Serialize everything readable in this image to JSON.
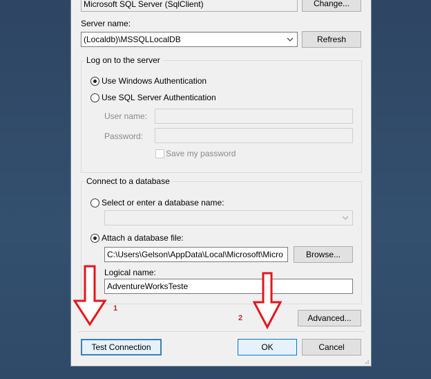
{
  "data_source": {
    "value": "Microsoft SQL Server (SqlClient)",
    "change_label": "Change..."
  },
  "server": {
    "label": "Server name:",
    "value": "(Localdb)\\MSSQLLocalDB",
    "refresh_label": "Refresh"
  },
  "logon": {
    "title": "Log on to the server",
    "windows_auth": "Use Windows Authentication",
    "sql_auth": "Use SQL Server Authentication",
    "username_label": "User name:",
    "password_label": "Password:",
    "save_password": "Save my password"
  },
  "connect": {
    "title": "Connect to a database",
    "select_db": "Select or enter a database name:",
    "attach_db": "Attach a database file:",
    "file_path": "C:\\Users\\Gelson\\AppData\\Local\\Microsoft\\Micro",
    "browse_label": "Browse...",
    "logical_label": "Logical name:",
    "logical_value": "AdventureWorksTeste"
  },
  "buttons": {
    "advanced": "Advanced...",
    "test_connection": "Test Connection",
    "ok": "OK",
    "cancel": "Cancel"
  },
  "annotations": {
    "one": "1",
    "two": "2",
    "arrow_color": "#e3161b"
  }
}
